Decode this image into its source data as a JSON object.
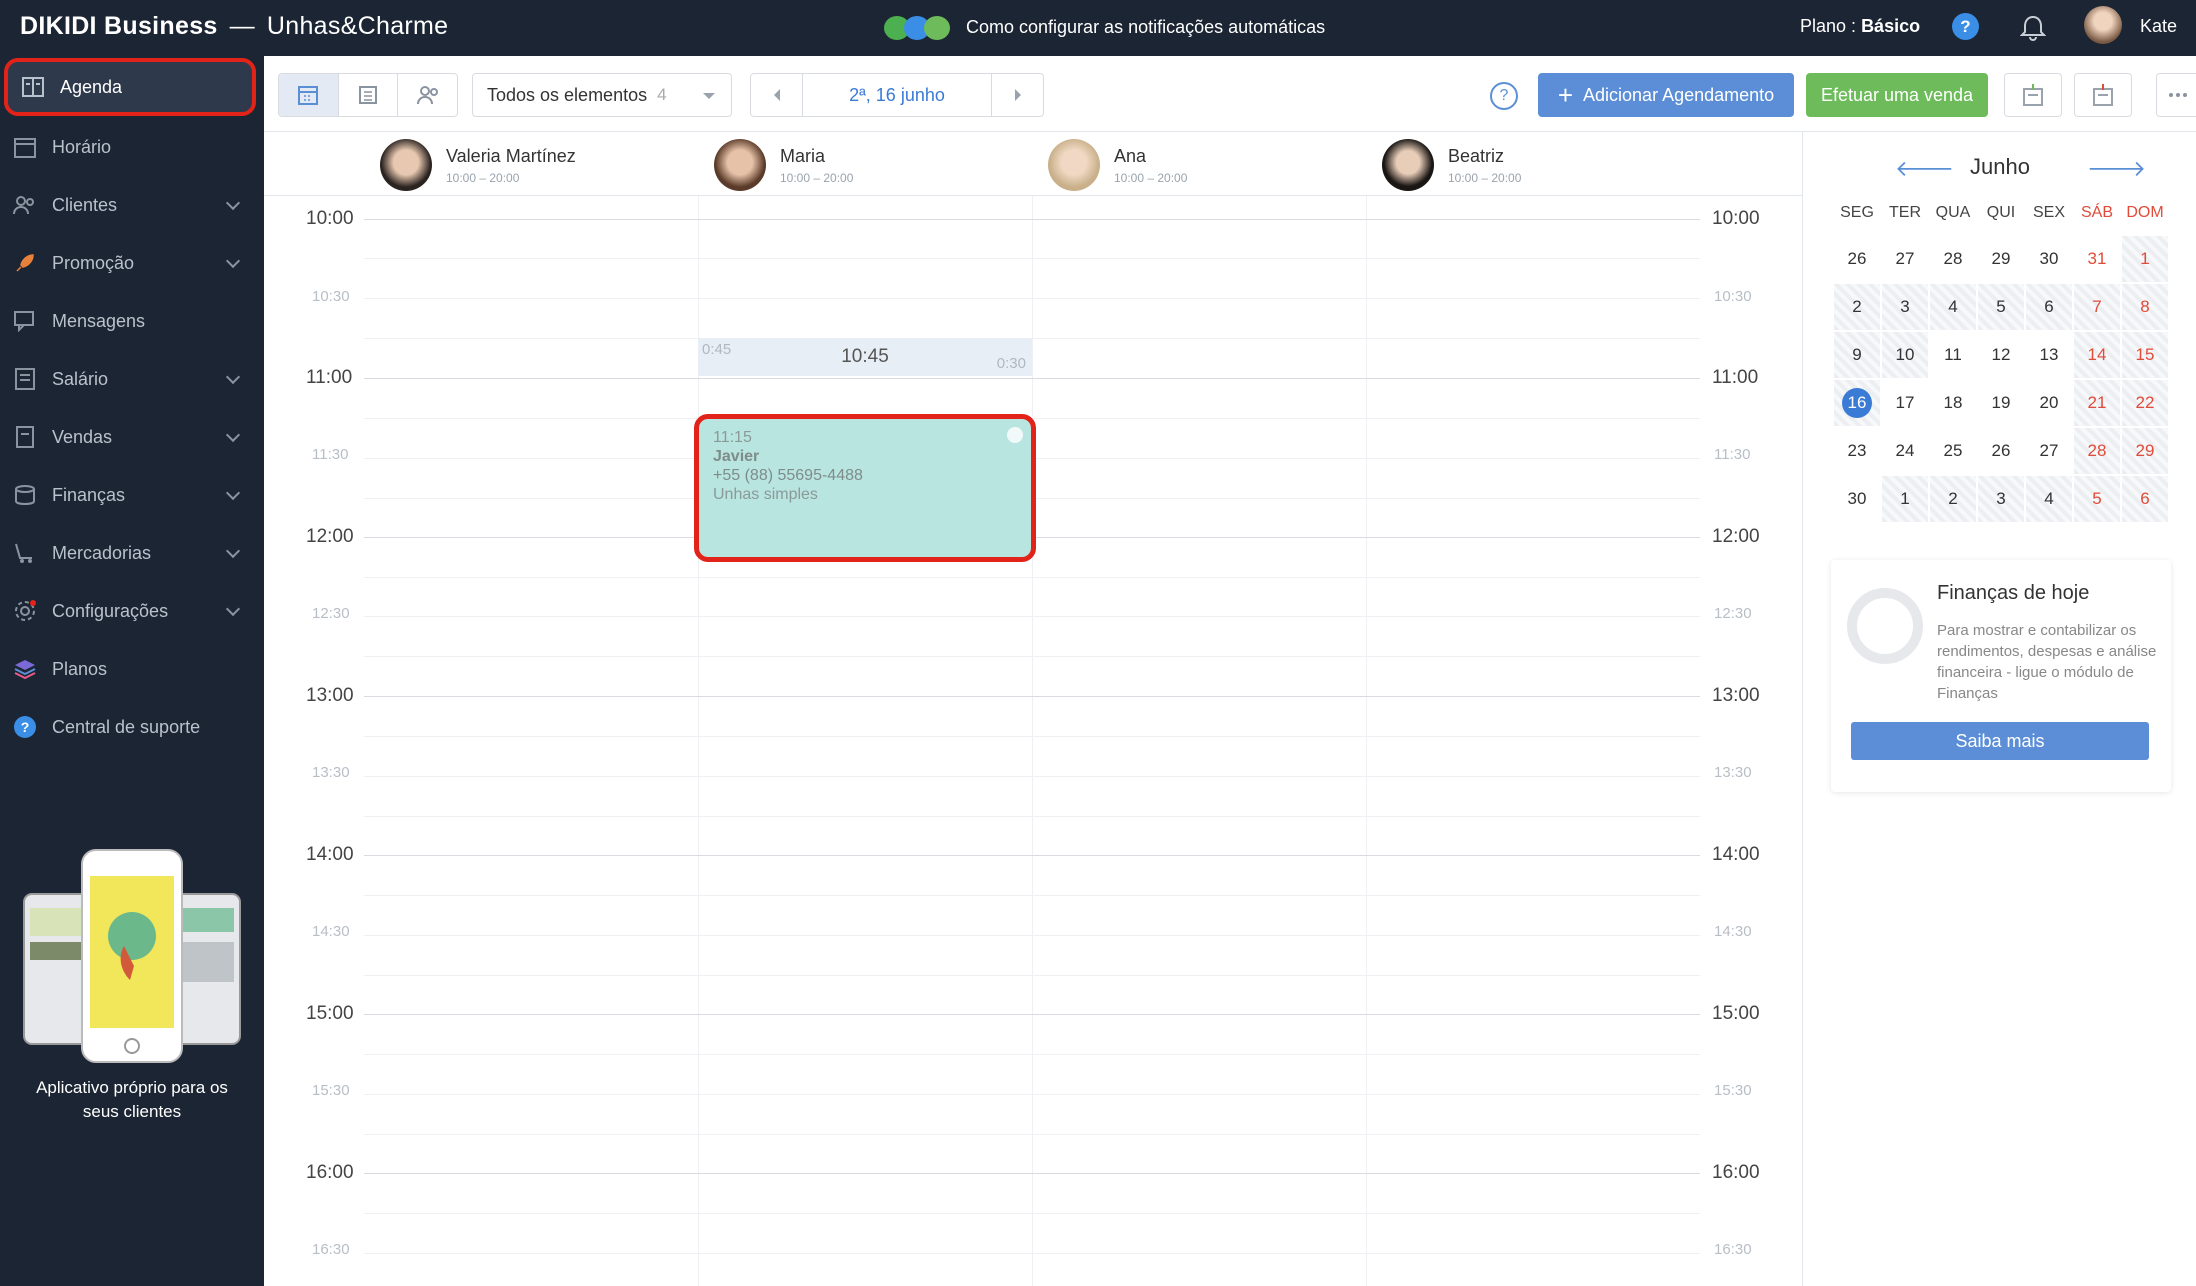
{
  "app": {
    "brand": "DIKIDI Business",
    "salon": "Unhas&Charme"
  },
  "notice": "Como configurar as notificações automáticas",
  "plan": {
    "label": "Plano :",
    "value": "Básico"
  },
  "user": {
    "name": "Kate"
  },
  "sidebar": {
    "items": [
      {
        "label": "Agenda",
        "icon": "agenda-icon",
        "active": true
      },
      {
        "label": "Horário",
        "icon": "calendar-icon"
      },
      {
        "label": "Clientes",
        "icon": "clients-icon"
      },
      {
        "label": "Promoção",
        "icon": "rocket-icon"
      },
      {
        "label": "Mensagens",
        "icon": "messages-icon"
      },
      {
        "label": "Salário",
        "icon": "salary-icon"
      },
      {
        "label": "Vendas",
        "icon": "sales-icon"
      },
      {
        "label": "Finanças",
        "icon": "finance-icon"
      },
      {
        "label": "Mercadorias",
        "icon": "goods-icon"
      },
      {
        "label": "Configurações",
        "icon": "gear-icon"
      },
      {
        "label": "Planos",
        "icon": "layers-icon"
      },
      {
        "label": "Central de suporte",
        "icon": "help-icon"
      }
    ],
    "promo_label": "Aplicativo próprio para os seus clientes"
  },
  "toolbar": {
    "filter_label": "Todos os elementos",
    "filter_count": "4",
    "date": "2ª, 16 junho",
    "add_label": "Adicionar Agendamento",
    "sale_label": "Efetuar uma venda"
  },
  "staff": [
    {
      "name": "Valeria Martínez",
      "hours": "10:00 – 20:00"
    },
    {
      "name": "Maria",
      "hours": "10:00 – 20:00"
    },
    {
      "name": "Ana",
      "hours": "10:00 – 20:00"
    },
    {
      "name": "Beatriz",
      "hours": "10:00 – 20:00"
    }
  ],
  "times": [
    "10:00",
    "10:30",
    "11:00",
    "11:30",
    "12:00",
    "12:30",
    "13:00",
    "13:30",
    "14:00",
    "14:30",
    "15:00",
    "15:30",
    "16:00",
    "16:30"
  ],
  "slot": {
    "before": "0:45",
    "time": "10:45",
    "after": "0:30"
  },
  "appointment": {
    "time": "11:15",
    "client": "Javier",
    "phone": "+55 (88) 55695-4488",
    "service": "Unhas simples"
  },
  "calendar": {
    "month": "Junho",
    "weekdays": [
      "SEG",
      "TER",
      "QUA",
      "QUI",
      "SEX",
      "SÁB",
      "DOM"
    ],
    "weeks": [
      [
        "26",
        "27",
        "28",
        "29",
        "30",
        "31",
        "1"
      ],
      [
        "2",
        "3",
        "4",
        "5",
        "6",
        "7",
        "8"
      ],
      [
        "9",
        "10",
        "11",
        "12",
        "13",
        "14",
        "15"
      ],
      [
        "16",
        "17",
        "18",
        "19",
        "20",
        "21",
        "22"
      ],
      [
        "23",
        "24",
        "25",
        "26",
        "27",
        "28",
        "29"
      ],
      [
        "30",
        "1",
        "2",
        "3",
        "4",
        "5",
        "6"
      ]
    ],
    "today": "16"
  },
  "finance": {
    "title": "Finanças de hoje",
    "description": "Para mostrar e contabilizar os rendimentos, despesas e análise financeira - ligue o módulo de Finanças",
    "button": "Saiba mais"
  },
  "colors": {
    "sidebar": "#1c2533",
    "accent": "#5b8ed6",
    "green": "#6dbb5a",
    "highlight": "#e2231a",
    "appointment": "#b9e5e0"
  }
}
